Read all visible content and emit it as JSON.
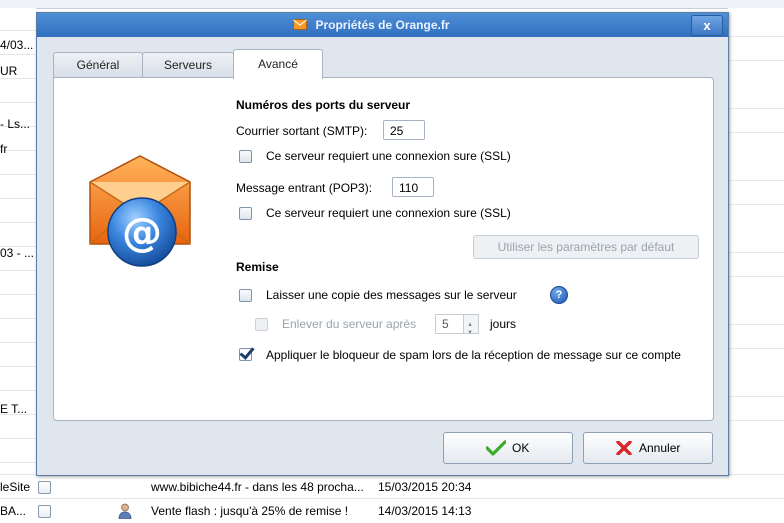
{
  "background": {
    "left_fragments": [
      "4/03...",
      "UR",
      "- Ls...",
      "fr",
      "03 - ...",
      "E T..."
    ],
    "rows": [
      {
        "sender": "leSite",
        "subject": "www.bibiche44.fr - dans les 48 procha...",
        "date": "15/03/2015 20:34"
      },
      {
        "sender": "BA...",
        "subject": "Vente flash : jusqu'à 25% de remise !",
        "date": "14/03/2015 14:13"
      }
    ]
  },
  "dialog": {
    "title": "Propriétés de Orange.fr",
    "close_label": "x",
    "tabs": [
      {
        "label": "Général",
        "active": false
      },
      {
        "label": "Serveurs",
        "active": false
      },
      {
        "label": "Avancé",
        "active": true
      }
    ],
    "ports": {
      "heading": "Numéros des ports du serveur",
      "smtp_label": "Courrier sortant (SMTP):",
      "smtp_value": "25",
      "smtp_ssl_label": "Ce serveur requiert une connexion sure (SSL)",
      "smtp_ssl_checked": false,
      "pop3_label": "Message entrant  (POP3):",
      "pop3_value": "110",
      "pop3_ssl_label": "Ce serveur requiert une connexion sure (SSL)",
      "pop3_ssl_checked": false,
      "defaults_button": "Utiliser les paramètres par défaut"
    },
    "delivery": {
      "heading": "Remise",
      "keep_copy_label": "Laisser une copie des messages sur le serveur",
      "keep_copy_checked": false,
      "help_label": "?",
      "remove_after_label": "Enlever du serveur après",
      "remove_after_value": "5",
      "days_label": "jours",
      "spam_label": "Appliquer le bloqueur de spam lors de la réception de message sur ce compte",
      "spam_checked": true
    },
    "buttons": {
      "ok": "OK",
      "cancel": "Annuler"
    },
    "colors": {
      "title_bar": "#3a7acb",
      "ok_check": "#3cab2a",
      "cancel_x": "#d8262a",
      "accent": "#1f56b0"
    }
  }
}
